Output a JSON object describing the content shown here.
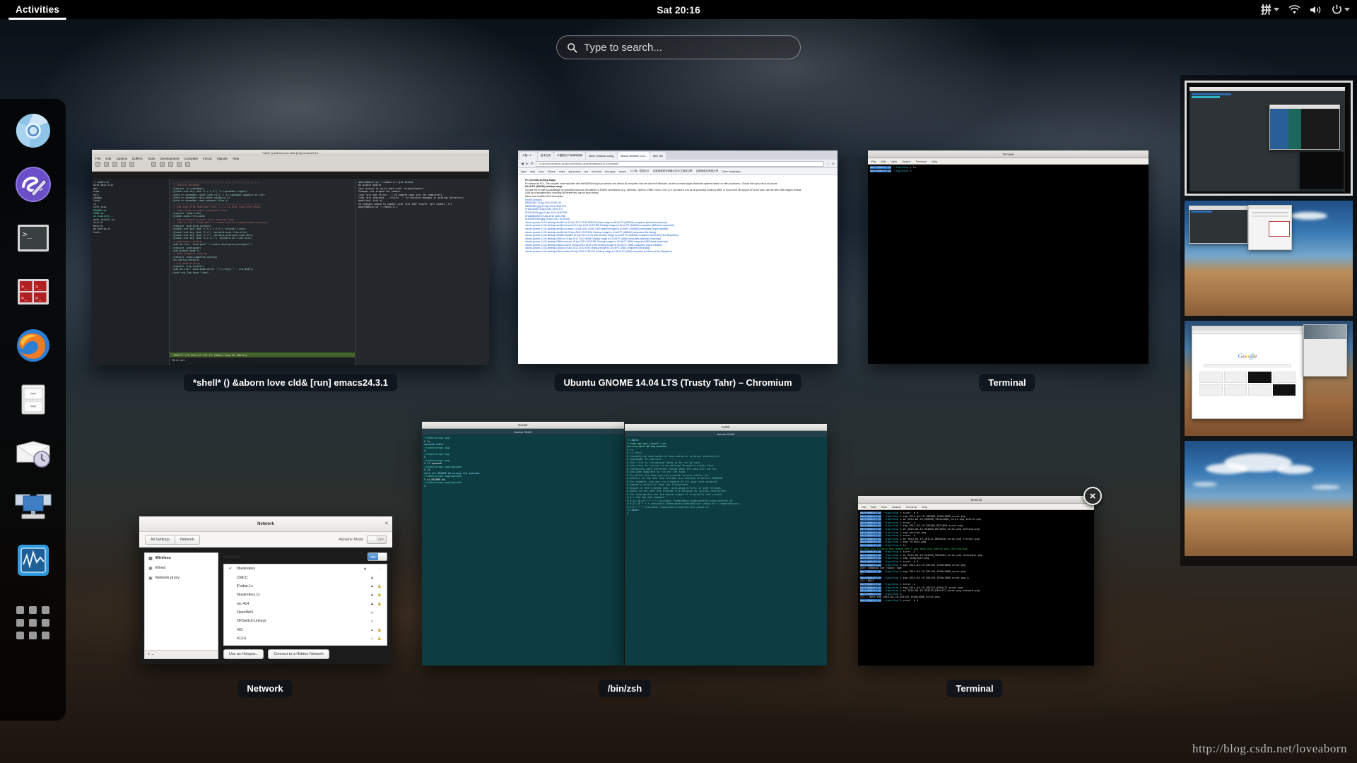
{
  "topbar": {
    "activities": "Activities",
    "clock": "Sat 20:16",
    "ime": "拼",
    "icons": [
      "ime-icon",
      "wifi-icon",
      "volume-icon",
      "power-icon"
    ]
  },
  "search": {
    "placeholder": "Type to search...",
    "value": "",
    "icon": "search-icon"
  },
  "dock": {
    "items": [
      {
        "name": "chromium",
        "label": "Chromium"
      },
      {
        "name": "emacs",
        "label": "Emacs"
      },
      {
        "name": "terminal",
        "label": "Terminal"
      },
      {
        "name": "terminator",
        "label": "Terminator"
      },
      {
        "name": "firefox",
        "label": "Firefox"
      },
      {
        "name": "files",
        "label": "Files"
      },
      {
        "name": "mail-scheduler",
        "label": "Mail"
      },
      {
        "name": "remote-desktop",
        "label": "Remote Desktop"
      },
      {
        "name": "system-monitor",
        "label": "System Monitor"
      }
    ],
    "app_grid_label": "Show Applications"
  },
  "windows": {
    "emacs": {
      "title": "*shell* () &aborn love cld&  [run] emacs24.3.1",
      "titlebar": "*shell* () &aborn love cld& [run] emacs24.3.1",
      "menu": [
        "File",
        "Edit",
        "Options",
        "Buffers",
        "Tools",
        "Development",
        "Complete",
        "In/Out",
        "Signals",
        "Help"
      ],
      "dired": [
        "~/.emacs.d/",
        "auto-save-list",
        "doc",
        "elpa",
        "evil",
        "images",
        "local",
        "rk",
        "site-lisp",
        "README.md",
        "TODO.md",
        "ac-complete...",
        "auto-install.el",
        "init.el",
        "keys.el",
        "my-config.el",
        "tools"
      ],
      "code": [
        ";;;;;;;;;;;;;;;;;;;;;;;;;;;;;;;;;;;;;;;;;;;;;;;;;;;;;;;;;;;;;",
        ";; setting speedbar",
        "(require 'sr-speedbar)",
        "(global-set-key (kbd \"C-c C-s\") 'sr-speedbar-toggle)",
        "(setq sr-speedbar-right-side nil)  ;; sr-speedbar appears on left",
        "(setq sr-speedbar-skip-other-window-p t)",
        "(setq sr-speedbar-show-unknown-files t)",
        "",
        ";;;;;;;;;;;;;;;;;;;;;;;;;;;;;;;;;;;;;;;;;;;;;;;;;;;;;;;;;;;;;",
        ";; add undo-tree download from, c-x u to show undo-tree graph",
        ";;             http://www.dr-qubit.org/emacs-tree/",
        "(require 'undo-tree)",
        "(global-undo-tree-mode)",
        ";; add nultiple-cursors, also working from",
        ";; (add-to-list 'load-path \"~/.emacs.d/site-lisp/multiple-cursors\")",
        "(require 'multiple-cursors)",
        "(global-set-key (kbd \"C-S-c C-S-c\") 'mc/edit-lines)",
        "(global-set-key (kbd \"C->\") 'mc/mark-next-like-this)",
        "(global-set-key (kbd \"C-<\") 'mc/mark-previous-like-this)",
        "(global-set-key (kbd \"C-c C-<\") 'mc/mark-all-like-this)",
        ";; yasnippet setting",
        "(add-to-list 'load-path \"~/.emacs.d/plugins/yasnippet\")",
        "(require 'yasnippet)",
        "(yas-global-mode 1)",
        ";; auto-complete setting",
        "(require 'auto-complete-config)",
        "(ac-config-default)",
        ";; org mode setting",
        "(require 'org-install)",
        "(add-to-list 'auto-mode-alist '(\"\\\\.org\\\\'\" . org-mode))",
        "(setq org-log-done 'time)"
      ],
      "shell": [
        "aborn@aborn-pc ~/.emacs.d % git status",
        "On branch master",
        "Your branch is up-to-date with 'origin/master'.",
        "",
        "Changes not staged for commit:",
        "  (use \"git add <file>...\" to update what will be committed)",
        "  (use \"git checkout -- <file>...\" to discard changes in working directory)",
        "",
        "        modified:   init.el",
        "",
        "no changes added to commit (use \"git add\" and/or \"git commit -a\")",
        "aborn@aborn-pc ~/.emacs.d %"
      ],
      "modeline": "-UUU:**--F1  init.el      All L1   (Emacs-Lisp AC Abbrev)",
      "echo": "Mark set"
    },
    "chromium": {
      "title": "Ubuntu GNOME 14.04 LTS (Trusty Tahr) – Chromium",
      "tabs": [
        "众智—1 ...",
        "技术交流",
        "中国知识产权局网络商",
        "aborn (Xiaobao Liang)",
        "Ubuntu GNOME 14.0...",
        "New Tab"
      ],
      "url": "cd.ubuntu-releases.ubuntu.com/ubuntu-gnome/releases/14.04/release/",
      "bookmarks": [
        "Apps",
        "lang",
        "Linux",
        "Emacs",
        "notes",
        "app.search",
        "vue",
        "front-end",
        "test-apps",
        "emacs",
        "人人网 - 校园社交",
        "百度搜索是全球最大的中文搜索引擎",
        "百度网盘互联网分享",
        "Other bookmarks"
      ],
      "content": [
        "PC (not x86) desktop image",
        "For almost all PCs. This includes most machines with Intel/AMD/etc type processors and almost all computers that run Microsoft Windows, as well as newer Apple Macintosh systems based on Intel processors. Choose this if you are at all unsure.",
        "64-bit PC (AMD64) desktop image",
        "Choose this to take full advantage of computers based on the AMD64 or EM64T architecture (e.g., Athlon64, Opteron, EM64T Xeon, Core 2). If you have a non-64-bit processor made by AMD, or if you need full support for 32-bit code, use the other i386 images instead.",
        "A full list of available files, including BitTorrent files, can be found below.",
        "Name                                 Last modified      Size   Description",
        "Parent Directory                                          -",
        "MD5SUMS                              19-Apr-2014 16:59   142",
        "MD5SUMS.gpg                          19-Apr-2014 16:59   916",
        "SHA1SUMS                             19-Apr-2014 16:59   174",
        "SHA1SUMS.gpg                         19-Apr-2014 16:59   916",
        "SHA256SUMS                           19-Apr-2014 16:59   238",
        "SHA256SUMS.gpg                       19-Apr-2014 16:59   916",
        "ubuntu-gnome-14.04-desktop-amd64.iso 19-Apr-2014 12:59  962M  Desktop image for 64-bit PC (AMD64) computers (standard download)",
        "ubuntu-gnome-14.04-desktop-amd64.iso.torrent 19-Apr-2014 16:59  38K  Desktop image for 64-bit PC (AMD64) computers (BitTorrent download)",
        "ubuntu-gnome-14.04-desktop-amd64.iso.zsync  19-Apr-2014 16:59 1.9M  Desktop image for 64-bit PC (AMD64) computers (zsync metafile)",
        "ubuntu-gnome-14.04-desktop-amd64.list 19-Apr-2014 12:59  8.5K  Desktop image for 64-bit PC (AMD64) computers (file listing)",
        "ubuntu-gnome-14.04-desktop-amd64.manifest 19-Apr-2014 12:54 50K  Desktop image for 64-bit PC (AMD64) computers (contents of live filesystem)",
        "ubuntu-gnome-14.04-desktop-i386.iso  19-Apr-2014 13:02  964M  Desktop image for 32-bit PC (i386) computers (standard download)",
        "ubuntu-gnome-14.04-desktop-i386.iso.torrent 19-Apr-2014 16:59  38K  Desktop image for 32-bit PC (i386) computers (BitTorrent download)",
        "ubuntu-gnome-14.04-desktop-i386.iso.zsync 19-Apr-2014 16:59 1.9M  Desktop image for 32-bit PC (i386) computers (zsync metafile)",
        "ubuntu-gnome-14.04-desktop-i386.list 19-Apr-2014 13:02  8.5K  Desktop image for 32-bit PC (i386) computers (file listing)",
        "ubuntu-gnome-14.04-desktop-i386.manifest 19-Apr-2014 12:58  50K  Desktop image for 32-bit PC (i386) computers (contents of live filesystem)"
      ]
    },
    "terminal_top": {
      "title": "Terminal",
      "titlebar": "Terminal",
      "menu": [
        "File",
        "Edit",
        "View",
        "Search",
        "Terminal",
        "Help"
      ],
      "lines": [
        {
          "prompt": "aborn@aborn-pc",
          "dir": "~/tmp/blog",
          "cmd": "% ls"
        },
        {
          "prompt": "aborn@aborn-pc",
          "dir": "~/tmp/blog",
          "cmd": "%"
        }
      ]
    },
    "terminal_bottom": {
      "title": "Terminal",
      "titlebar": "Terminal",
      "menu": [
        "File",
        "Edit",
        "View",
        "Search",
        "Terminal",
        "Help"
      ],
      "close_icon": "close-icon",
      "lines": [
        {
          "prompt": "aborn@aborn-pc",
          "dir": "~/tmp/blog",
          "cmd": "% scrot -d 4"
        },
        {
          "prompt": "aborn@aborn-pc",
          "dir": "~/tmp/blog",
          "cmd": "% eog 2014-04-19-200908_1920x1080_scrot.png"
        },
        {
          "prompt": "aborn@aborn-pc",
          "dir": "~/tmp/blog",
          "cmd": "% mv 2014-04-19-200908_1920x1080_scrot.png search.png"
        },
        {
          "prompt": "aborn@aborn-pc",
          "dir": "~/tmp/blog",
          "cmd": "% scrot -s"
        },
        {
          "prompt": "aborn@aborn-pc",
          "dir": "~/tmp/blog",
          "cmd": "% eog 2014-04-19-201003_857x654_scrot.png"
        },
        {
          "prompt": "aborn@aborn-pc",
          "dir": "~/tmp/blog",
          "cmd": "% mv 2014-04-19-201003_857x654_scrot.png setting.png"
        },
        {
          "prompt": "aborn@aborn-pc",
          "dir": "~/tmp/blog",
          "cmd": "% eog setting.png"
        },
        {
          "prompt": "aborn@aborn-pc",
          "dir": "~/tmp/blog",
          "cmd": "% scrot -s"
        },
        {
          "prompt": "aborn@aborn-pc",
          "dir": "~/tmp/blog",
          "cmd": "% mv 2014-04-19-201111_889x620_scrot.png filesys.png"
        },
        {
          "prompt": "aborn@aborn-pc",
          "dir": "~/tmp/blog",
          "cmd": "% eog filesys.png"
        },
        {
          "prompt": "aborn@aborn-pc",
          "dir": "~/tmp/blog",
          "cmd": "% ls"
        },
        {
          "out_green": "chrome.png  filesys.png  gnome-shell.png  menu.png  search.png  setting.png"
        },
        {
          "prompt": "aborn@aborn-pc",
          "dir": "~/tmp/blog",
          "cmd": "% scrot -s"
        },
        {
          "prompt": "aborn@aborn-pc",
          "dir": "~/tmp/blog",
          "cmd": "% mv 2014-04-19-201343_955x581_scrot.png langregin.png"
        },
        {
          "prompt": "aborn@aborn-pc",
          "dir": "~/tmp/blog",
          "cmd": "% eog langregin.png"
        },
        {
          "prompt": "aborn@aborn-pc",
          "dir": "~/tmp/blog",
          "cmd": "% scrot -d 4"
        },
        {
          "prompt": "aborn@aborn-pc",
          "dir": "~/tmp/blog",
          "cmd": "% ego 2014-04-19-201443_1920x1080_scrot.png"
        },
        {
          "out_white": "zsh: command not found: ego"
        },
        {
          "prompt": "aborn@aborn-pc",
          "dir": "~/tmp/blog",
          "cmd": "% eog 2014-04-19-201443_1920x1080_scrot.png"
        },
        {
          "out_white": "^C"
        },
        {
          "prompt": "aborn@aborn-pc",
          "dir": "~/tmp/blog",
          "cmd": "% eog 2014-04-19-201443_1920x1080_scrot.png &"
        },
        {
          "out_white": "[1] 10613"
        },
        {
          "prompt": "aborn@aborn-pc",
          "dir": "~/tmp/blog",
          "cmd": "% scrot -s"
        },
        {
          "prompt": "aborn@aborn-pc",
          "dir": "~/tmp/blog",
          "cmd": "% eog 2014-04-19-201513_639x377_scrot.png"
        },
        {
          "prompt": "aborn@aborn-pc",
          "dir": "~/tmp/blog",
          "cmd": "% mv 2014-04-19-201513_639x377_scrot.png network.png"
        },
        {
          "prompt": "aborn@aborn-pc",
          "dir": "~/tmp/blog",
          "cmd": "%"
        },
        {
          "out_white": "[1]  + done       eog 2014-04-19-201443_1920x1080_scrot.png"
        },
        {
          "prompt": "aborn@aborn-pc",
          "dir": "~/tmp/blog",
          "cmd": "% scrot -d 4"
        }
      ]
    },
    "zsh": {
      "title": "/bin/zsh",
      "left_titlebar": "Navbar",
      "left_tab": "Navbar 92x52",
      "right_titlebar": "iteshh",
      "right_tab": "devzsh 92x52",
      "left_lines": [
        {
          "dir": "~/code/scrapy.app",
          "cmd": "% ls"
        },
        {
          "out": "spacweb  table"
        },
        {
          "dir": "~/code/scrapy.app",
          "cmd": "%"
        },
        {
          "dir": "~/code/scrapy.app",
          "cmd": "%"
        },
        {
          "dir": "~/code/scrapy.app",
          "cmd": "% ll spacweb"
        },
        {
          "dir": "~/code/scrapy.app/spacweb",
          "cmd": "% ls"
        },
        {
          "out": "info.txt  README.md  scrapy.cfg  spacweb"
        },
        {
          "dir": "~/code/scrapy.app/spacweb",
          "cmd": "% vi README.md"
        },
        {
          "dir": "~/code/scrapy.app/spacweb",
          "cmd": "%"
        }
      ],
      "right_lines": [
        "~/.zshrc",
        "% sudo apt-get install zsh",
        "env-variable  OB  bug  weather",
        "% ls",
        "# ~/.zshrc",
        "# resembly.zg  news-weibo.sh  news-weibo.sh  sctproxy  setproxy.sh",
        "# spaceweb/ at-two-site",
        "# this file is introduced loads to be run by root",
        "",
        "# each test to run sws to be defined through a single task",
        "# containing with different fields when the task will be run",
        "# and when complete to run for the task",
        "",
        "# To define the home you can provide various values for",
        "# default to the user the crontab file belongs to before CRONTAB",
        "",
        "# For example, you can run a backup of all your user accounts",
        "# daemon's notice of time now filesystems",
        "",
        "# Output of the crontab jobs (including errors) is sent through",
        "# email to the user the crontab file belongs to (unless redirected)",
        "",
        "# For information see the manual pages of crontab(5) and cron(8)",
        "",
        "# m h dom mon dow  command",
        "# 0,15,30,45 * * * * /bin/bash /home/aborn/code/weather/send-weather.sh",
        "# 0,17,30 * * * /bin/bash /home/aborn/code/deliver-weibo.sh > /home/aborn/w...",
        "# 0 8 * * * /bin/bash /home/aborn/code/deliver-weibo.sh",
        "~/.zshrc",
        "%"
      ]
    },
    "network": {
      "title": "Network",
      "titlebar": "Network",
      "close_icon": "close-icon",
      "buttons": {
        "all_settings": "All Settings",
        "network": "Network"
      },
      "airplane_label": "Airplane Mode",
      "airplane_state": "OFF",
      "sidebar": [
        {
          "label": "Wireless",
          "icon": "wireless-icon",
          "selected": true
        },
        {
          "label": "Wired",
          "icon": "wired-icon",
          "selected": false
        },
        {
          "label": "Network proxy",
          "icon": "proxy-icon",
          "selected": false
        }
      ],
      "section_label": "Wireless",
      "wireless_state": "ON",
      "networks": [
        {
          "ssid": "fduwireless",
          "connected": true,
          "secure": false,
          "strength": 4,
          "arrow": true
        },
        {
          "ssid": "CMCC",
          "connected": false,
          "secure": false,
          "strength": 4
        },
        {
          "ssid": "iFudan.1x",
          "connected": false,
          "secure": true,
          "strength": 4
        },
        {
          "ssid": "fduwireless.1x",
          "connected": false,
          "secure": true,
          "strength": 4
        },
        {
          "ssid": "mc-414",
          "connected": false,
          "secure": true,
          "strength": 4
        },
        {
          "ssid": "OpenWrt1",
          "connected": false,
          "secure": false,
          "strength": 3
        },
        {
          "ssid": "OFSwitch-Linksys",
          "connected": false,
          "secure": false,
          "strength": 2
        },
        {
          "ssid": "401",
          "connected": false,
          "secure": true,
          "strength": 3
        },
        {
          "ssid": "413-6",
          "connected": false,
          "secure": true,
          "strength": 2
        }
      ],
      "footer": {
        "hotspot": "Use as Hotspot...",
        "hidden": "Connect to a Hidden Network",
        "add": "+",
        "remove": "–"
      }
    }
  },
  "workspaces": [
    {
      "name": "workspace-1",
      "active": true
    },
    {
      "name": "workspace-2",
      "active": false
    },
    {
      "name": "workspace-3",
      "active": false
    },
    {
      "name": "workspace-4",
      "active": false
    }
  ],
  "watermark": "http://blog.csdn.net/loveaborn",
  "colors": {
    "topbar_bg": "#000000",
    "accent": "#4a86c6",
    "terminal_prompt": "#2b6cb0",
    "terminal_dir": "#2fb5c6",
    "zsh_bg": "#0d3d42",
    "selection": "#d9d9d9"
  }
}
